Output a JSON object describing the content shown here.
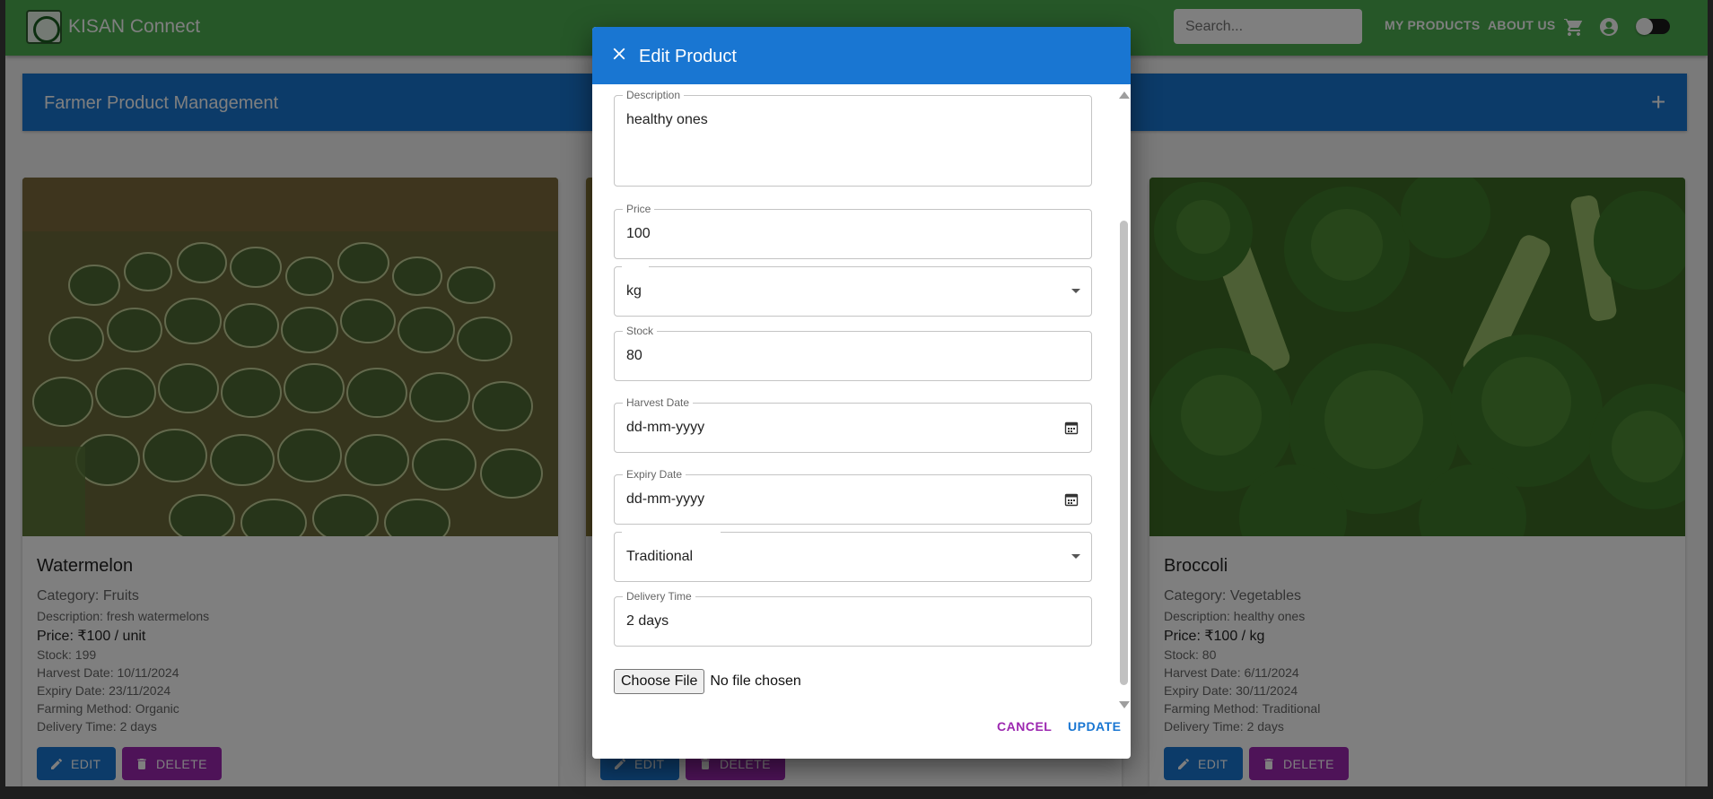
{
  "appbar": {
    "brand": "KISAN Connect",
    "search_placeholder": "Search...",
    "nav": [
      "MY PRODUCTS",
      "ABOUT US"
    ]
  },
  "banner": {
    "title": "Farmer Product Management"
  },
  "cards": [
    {
      "title": "Watermelon",
      "category": "Category: Fruits",
      "description": "Description: fresh watermelons",
      "price": "Price: ₹100 / unit",
      "stock": "Stock: 199",
      "harvest": "Harvest Date: 10/11/2024",
      "expiry": "Expiry Date: 23/11/2024",
      "method": "Farming Method: Organic",
      "delivery": "Delivery Time: 2 days",
      "edit_label": "EDIT",
      "delete_label": "DELETE"
    },
    {
      "edit_label": "EDIT",
      "delete_label": "DELETE"
    },
    {
      "title": "Broccoli",
      "category": "Category: Vegetables",
      "description": "Description: healthy ones",
      "price": "Price: ₹100 / kg",
      "stock": "Stock: 80",
      "harvest": "Harvest Date: 6/11/2024",
      "expiry": "Expiry Date: 30/11/2024",
      "method": "Farming Method: Traditional",
      "delivery": "Delivery Time: 2 days",
      "edit_label": "EDIT",
      "delete_label": "DELETE"
    }
  ],
  "dialog": {
    "title": "Edit Product",
    "fields": {
      "description": {
        "label": "Description",
        "value": "healthy ones"
      },
      "price": {
        "label": "Price",
        "value": "100"
      },
      "unit": {
        "value": "kg"
      },
      "stock": {
        "label": "Stock",
        "value": "80"
      },
      "harvest": {
        "label": "Harvest Date",
        "value": "dd-mm-yyyy"
      },
      "expiry": {
        "label": "Expiry Date",
        "value": "dd-mm-yyyy"
      },
      "method": {
        "value": "Traditional"
      },
      "delivery": {
        "label": "Delivery Time",
        "value": "2 days"
      }
    },
    "file": {
      "button": "Choose File",
      "status": "No file chosen"
    },
    "actions": {
      "cancel": "CANCEL",
      "update": "UPDATE"
    }
  },
  "colors": {
    "appbar": "#4caf50",
    "primary": "#1976d2",
    "secondary": "#9c27b0"
  }
}
